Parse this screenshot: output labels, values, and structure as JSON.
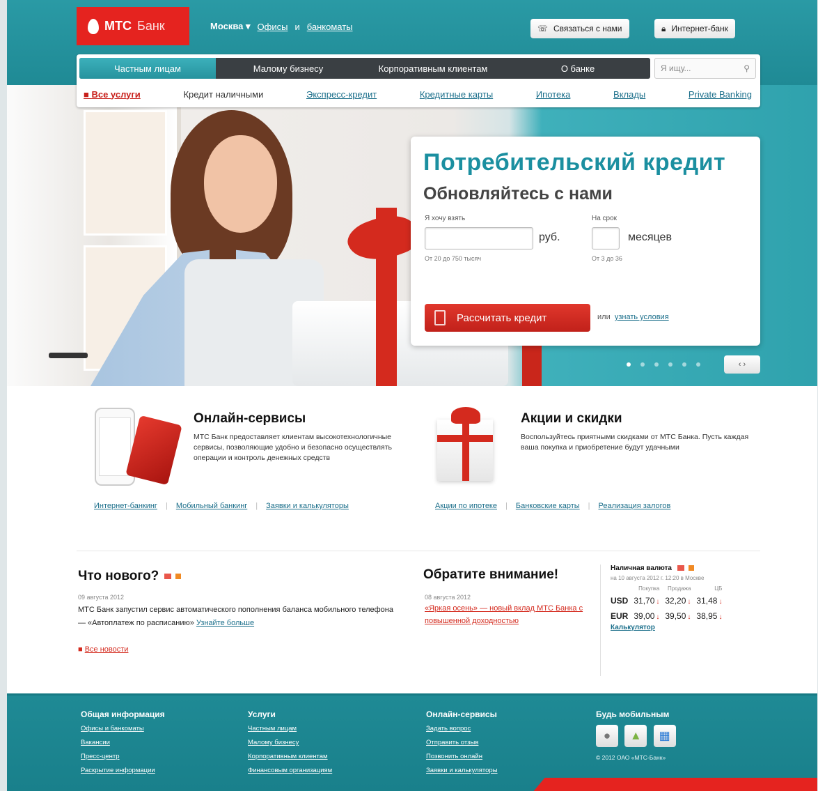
{
  "header": {
    "logo_mark": "МТС",
    "logo_text": "Банк",
    "city": "Москва ▾",
    "offices_link": "Офисы",
    "and": "и",
    "atms_link": "банкоматы",
    "contact_button": "Связаться с нами",
    "internet_bank_button": "Интернет-банк"
  },
  "nav": {
    "tabs": [
      "Частным лицам",
      "Малому бизнесу",
      "Корпоративным клиентам",
      "О банке"
    ],
    "search_placeholder": "Я ищу...",
    "subnav": [
      "Все услуги",
      "Кредит наличными",
      "Экспресс-кредит",
      "Кредитные карты",
      "Ипотека",
      "Вклады",
      "Private Banking"
    ]
  },
  "hero": {
    "title": "Потребительский кредит",
    "subtitle": "Обновляйтесь с нами",
    "amount_label": "Я хочу взять",
    "amount_unit": "руб.",
    "amount_hint": "От 20 до 750 тысяч",
    "term_label": "На срок",
    "term_unit": "месяцев",
    "term_hint": "От 3 до 36",
    "calc_button": "Рассчитать кредит",
    "or_text": "или",
    "conditions_link": "узнать условия",
    "slider_dots": 6,
    "slider_active": 1,
    "arrows": "‹ ›"
  },
  "promo": {
    "online": {
      "title": "Онлайн-сервисы",
      "text": "МТС Банк предоставляет клиентам высокотехнологичные сервисы, позволяющие удобно и безопасно осуществлять операции и контроль денежных средств",
      "links": [
        "Интернет-банкинг",
        "Мобильный банкинг",
        "Заявки и калькуляторы"
      ]
    },
    "deals": {
      "title": "Акции и скидки",
      "text": "Воспользуйтесь приятными скидками от МТС Банка. Пусть каждая ваша покупка и приобретение будут удачными",
      "links": [
        "Акции по ипотеке",
        "Банковские карты",
        "Реализация залогов"
      ]
    }
  },
  "news": {
    "title": "Что нового?",
    "date": "09 августа 2012",
    "text": "МТС Банк запустил сервис автоматического пополнения баланса мобильного телефона — «Автоплатеж по расписанию»",
    "more_link": "Узнайте больше",
    "all_news": "Все новости"
  },
  "attention": {
    "title": "Обратите внимание!",
    "date": "08 августа 2012",
    "link": "«Яркая осень» — новый вклад МТС Банка с повышенной доходностью"
  },
  "rates": {
    "title": "Наличная валюта",
    "date": "на 10 августа 2012 г. 12:20 в Москве",
    "headers": [
      "",
      "Покупка",
      "Продажа",
      "ЦБ"
    ],
    "rows": [
      {
        "cur": "USD",
        "buy": "31,70",
        "sell": "32,20",
        "cb": "31,48"
      },
      {
        "cur": "EUR",
        "buy": "39,00",
        "sell": "39,50",
        "cb": "38,95"
      }
    ],
    "calculator": "Калькулятор"
  },
  "footer": {
    "cols": [
      {
        "title": "Общая информация",
        "links": [
          "Офисы и банкоматы",
          "Вакансии",
          "Пресс-центр",
          "Раскрытие информации"
        ]
      },
      {
        "title": "Услуги",
        "links": [
          "Частным лицам",
          "Малому бизнесу",
          "Корпоративным клиентам",
          "Финансовым организациям"
        ]
      },
      {
        "title": "Онлайн-сервисы",
        "links": [
          "Задать вопрос",
          "Отправить отзыв",
          "Позвонить онлайн",
          "Заявки и калькуляторы"
        ]
      }
    ],
    "mobile_title": "Будь мобильным",
    "copyright": "© 2012 ОАО «МТС-Банк»"
  },
  "colors": {
    "brand_red": "#e5231f",
    "teal": "#1f8a95",
    "accent_blue": "#1b8fa0"
  }
}
